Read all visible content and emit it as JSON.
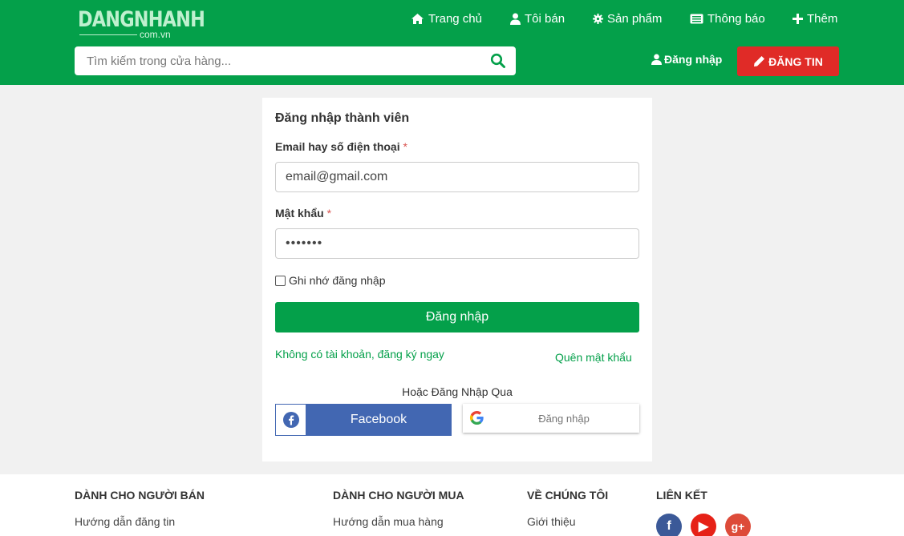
{
  "header": {
    "logo_main": "DANGNHANH",
    "logo_sub": "com.vn",
    "nav": [
      {
        "label": "Trang chủ",
        "icon": "home-icon"
      },
      {
        "label": "Tôi bán",
        "icon": "user-icon"
      },
      {
        "label": "Sản phẩm",
        "icon": "gear-icon"
      },
      {
        "label": "Thông báo",
        "icon": "newspaper-icon"
      },
      {
        "label": "Thêm",
        "icon": "plus-icon"
      }
    ],
    "search": {
      "placeholder": "Tìm kiếm trong cửa hàng...",
      "value": ""
    },
    "login_label": "Đăng nhập",
    "post_label": "ĐĂNG TIN"
  },
  "login_form": {
    "title": "Đăng nhập thành viên",
    "email_label": "Email hay số điện thoại",
    "email_value": "email@gmail.com",
    "password_label": "Mật khẩu",
    "password_value": "•••••••",
    "required_mark": "*",
    "remember_label": "Ghi nhớ đăng nhập",
    "remember_checked": false,
    "submit_label": "Đăng nhập",
    "register_link": "Không có tài khoản, đăng ký ngay",
    "forgot_link": "Quên mật khẩu",
    "or_text": "Hoặc Đăng Nhập Qua",
    "facebook_label": "Facebook",
    "google_label": "Đăng nhập"
  },
  "footer": {
    "columns": [
      {
        "heading": "DÀNH CHO NGƯỜI BÁN",
        "link": "Hướng dẫn đăng tin"
      },
      {
        "heading": "DÀNH CHO NGƯỜI MUA",
        "link": "Hướng dẫn mua hàng"
      },
      {
        "heading": "VỀ CHÚNG TÔI",
        "link": "Giới thiệu"
      },
      {
        "heading": "LIÊN KẾT"
      }
    ],
    "social": {
      "facebook": "f",
      "youtube": "▶",
      "google_plus": "g+"
    }
  },
  "colors": {
    "brand_green": "#04a04a",
    "post_red": "#e02b27",
    "facebook_blue": "#4267b2",
    "background": "#f1f1f1"
  }
}
